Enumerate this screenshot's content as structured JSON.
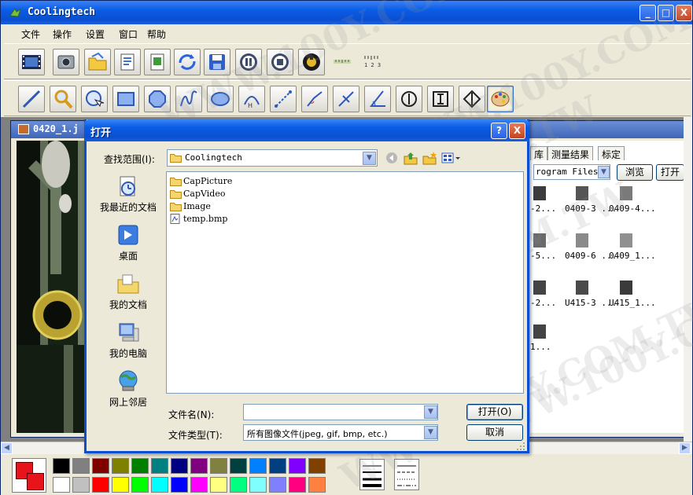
{
  "app": {
    "title": "Coolingtech",
    "menu": [
      "文件",
      "操作",
      "设置",
      "窗口",
      "帮助"
    ],
    "window_buttons": {
      "minimize": "_",
      "maximize": "□",
      "close": "X"
    }
  },
  "document": {
    "title": "0420_1.j"
  },
  "right_panel": {
    "tabs": [
      "库",
      "测量结果",
      "标定"
    ],
    "path": "rogram Files",
    "browse_label": "浏览",
    "open_label": "打开",
    "thumbnails": [
      {
        "label": "-2..."
      },
      {
        "label": "0409-3 ..."
      },
      {
        "label": "0409-4..."
      },
      {
        "label": "-5..."
      },
      {
        "label": "0409-6 ..."
      },
      {
        "label": "0409_1..."
      },
      {
        "label": "-2..."
      },
      {
        "label": "U415-3 ..."
      },
      {
        "label": "U415_1..."
      },
      {
        "label": "1..."
      }
    ]
  },
  "dialog": {
    "title": "打开",
    "help_label": "?",
    "close_label": "X",
    "look_in_label": "查找范围(I):",
    "look_in_value": "Coolingtech",
    "places": [
      {
        "label": "我最近的文档",
        "icon": "recent-documents-icon"
      },
      {
        "label": "桌面",
        "icon": "desktop-icon"
      },
      {
        "label": "我的文档",
        "icon": "my-documents-icon"
      },
      {
        "label": "我的电脑",
        "icon": "my-computer-icon"
      },
      {
        "label": "网上邻居",
        "icon": "network-places-icon"
      }
    ],
    "files": [
      {
        "name": "CapPicture",
        "type": "folder"
      },
      {
        "name": "CapVideo",
        "type": "folder"
      },
      {
        "name": "Image",
        "type": "folder"
      },
      {
        "name": "temp.bmp",
        "type": "bitmap"
      }
    ],
    "file_name_label": "文件名(N):",
    "file_name_value": "",
    "file_type_label": "文件类型(T):",
    "file_type_value": "所有图像文件(jpeg, gif, bmp, etc.)",
    "open_button": "打开(O)",
    "cancel_button": "取消"
  },
  "watermark": "WWW.100Y.COM.TW",
  "colors": {
    "xp_blue": "#0a5ce6",
    "current_foreground": "#e8141c",
    "palette_top": [
      "#000000",
      "#808080",
      "#800000",
      "#808000",
      "#008000",
      "#008080",
      "#000080",
      "#800080",
      "#808040",
      "#004040",
      "#0080ff",
      "#004080",
      "#8000ff",
      "#804000"
    ],
    "palette_bottom": [
      "#ffffff",
      "#c0c0c0",
      "#ff0000",
      "#ffff00",
      "#00ff00",
      "#00ffff",
      "#0000ff",
      "#ff00ff",
      "#ffff80",
      "#00ff80",
      "#80ffff",
      "#8080ff",
      "#ff0080",
      "#ff8040"
    ]
  }
}
